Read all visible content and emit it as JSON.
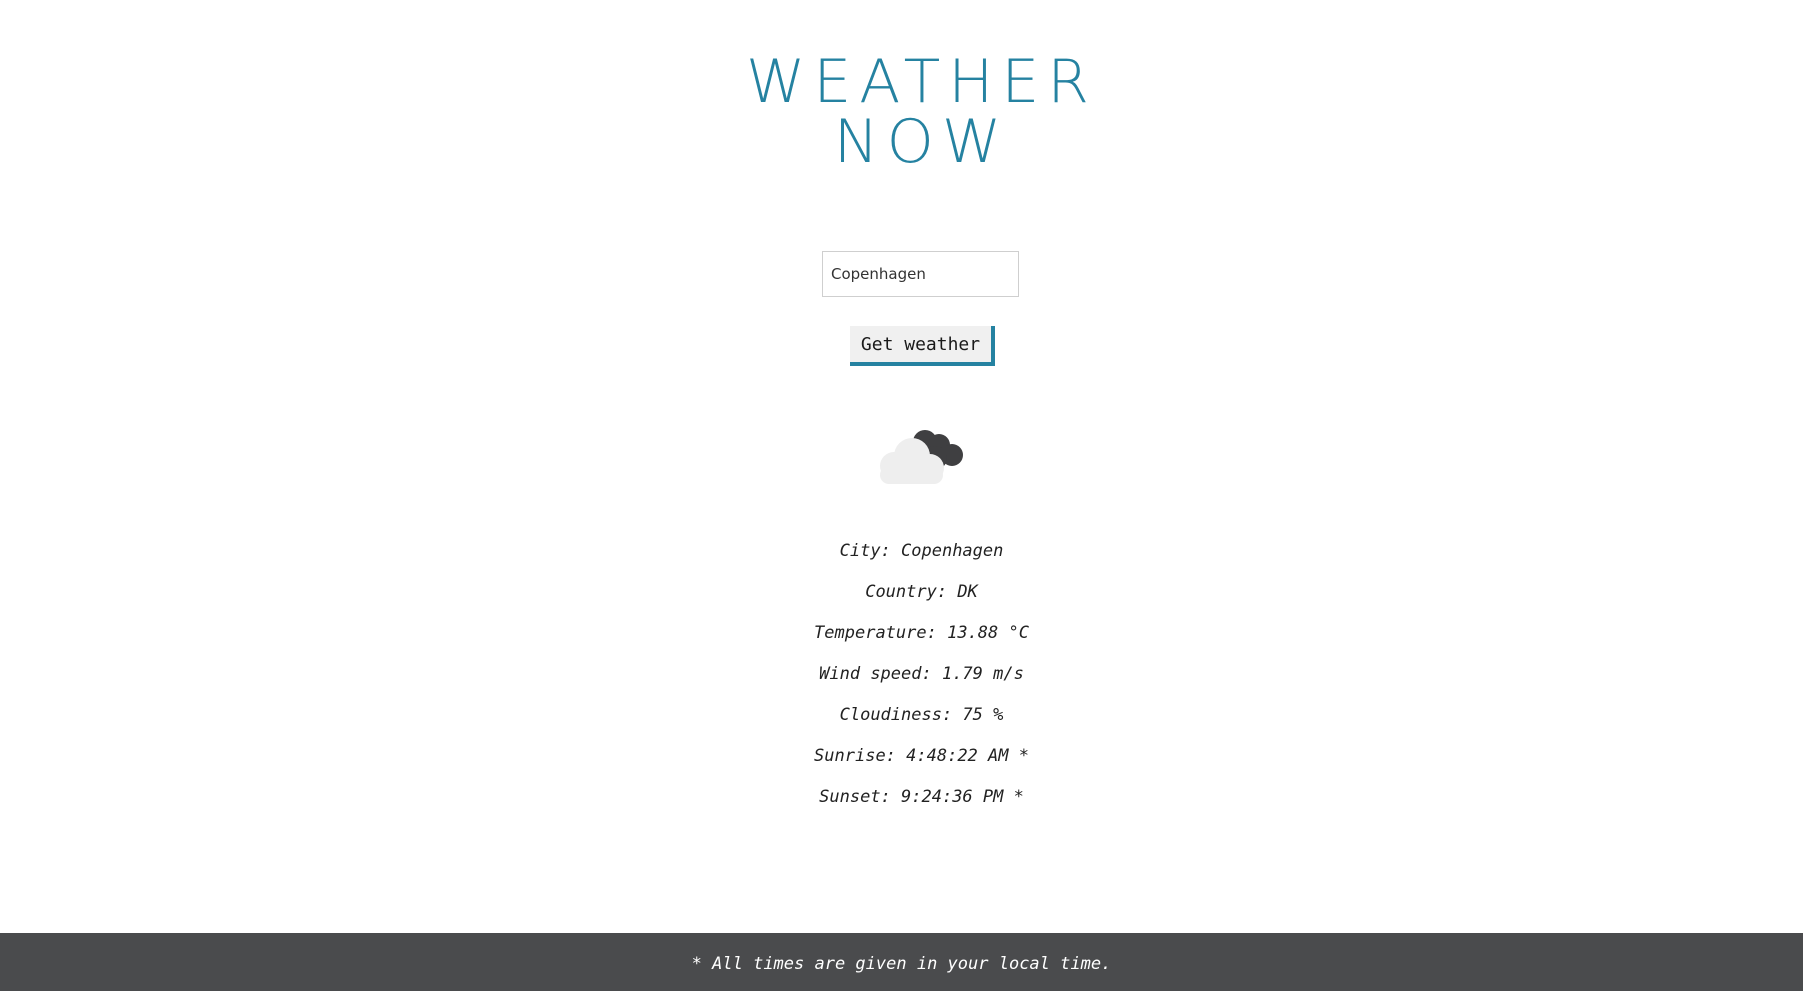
{
  "app": {
    "title_line1": "WEATHER",
    "title_line2": "NOW"
  },
  "search": {
    "value": "Copenhagen",
    "button_label": "Get weather"
  },
  "weather": {
    "icon": "cloudy-icon",
    "lines": [
      "City: Copenhagen",
      "Country: DK",
      "Temperature: 13.88 °C",
      "Wind speed: 1.79 m/s",
      "Cloudiness: 75 %",
      "Sunrise: 4:48:22 AM *",
      "Sunset: 9:24:36 PM *"
    ]
  },
  "footer": {
    "note": "* All times are given in your local time."
  },
  "colors": {
    "accent": "#2582a1",
    "footer_background": "#4a4b4d",
    "button_background": "#f0f0f0"
  }
}
